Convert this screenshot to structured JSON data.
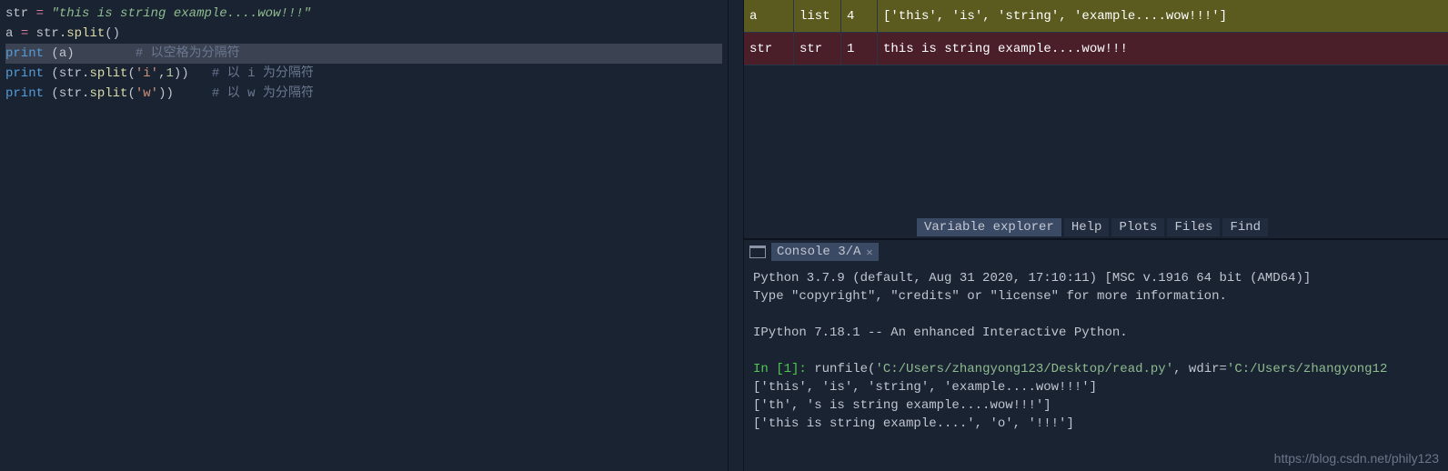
{
  "editor": {
    "lines": [
      {
        "spans": [
          {
            "t": "str",
            "c": "var"
          },
          {
            "t": " ",
            "c": ""
          },
          {
            "t": "=",
            "c": "op"
          },
          {
            "t": " ",
            "c": ""
          },
          {
            "t": "\"this is string example....wow!!!\"",
            "c": "str"
          }
        ]
      },
      {
        "spans": [
          {
            "t": "a ",
            "c": "var"
          },
          {
            "t": "=",
            "c": "op"
          },
          {
            "t": " str",
            "c": "var"
          },
          {
            "t": ".",
            "c": ""
          },
          {
            "t": "split",
            "c": "fn"
          },
          {
            "t": "()",
            "c": ""
          }
        ]
      },
      {
        "highlight": true,
        "spans": [
          {
            "t": "print",
            "c": "kw"
          },
          {
            "t": " (a)        ",
            "c": ""
          },
          {
            "t": "# 以空格为分隔符",
            "c": "cmt"
          }
        ]
      },
      {
        "spans": [
          {
            "t": "print",
            "c": "kw"
          },
          {
            "t": " (str",
            "c": ""
          },
          {
            "t": ".",
            "c": ""
          },
          {
            "t": "split",
            "c": "fn"
          },
          {
            "t": "(",
            "c": ""
          },
          {
            "t": "'i'",
            "c": "strq"
          },
          {
            "t": ",",
            "c": ""
          },
          {
            "t": "1",
            "c": "num"
          },
          {
            "t": "))   ",
            "c": ""
          },
          {
            "t": "# 以 i 为分隔符",
            "c": "cmt"
          }
        ]
      },
      {
        "spans": [
          {
            "t": "print",
            "c": "kw"
          },
          {
            "t": " (str",
            "c": ""
          },
          {
            "t": ".",
            "c": ""
          },
          {
            "t": "split",
            "c": "fn"
          },
          {
            "t": "(",
            "c": ""
          },
          {
            "t": "'w'",
            "c": "strq"
          },
          {
            "t": "))     ",
            "c": ""
          },
          {
            "t": "# 以 w 为分隔符",
            "c": "cmt"
          }
        ]
      }
    ]
  },
  "variables": [
    {
      "name": "a",
      "type": "list",
      "size": "4",
      "value": "['this', 'is', 'string', 'example....wow!!!']",
      "rowclass": "row-a"
    },
    {
      "name": "str",
      "type": "str",
      "size": "1",
      "value": "this is string example....wow!!!",
      "rowclass": "row-str"
    }
  ],
  "tabs": {
    "items": [
      {
        "label": "Variable explorer",
        "active": true
      },
      {
        "label": "Help",
        "active": false
      },
      {
        "label": "Plots",
        "active": false
      },
      {
        "label": "Files",
        "active": false
      },
      {
        "label": "Find",
        "active": false
      }
    ]
  },
  "console": {
    "tab_label": "Console 3/A",
    "lines": [
      {
        "spans": [
          {
            "t": "Python 3.7.9 (default, Aug 31 2020, 17:10:11) [MSC v.1916 64 bit (AMD64)]",
            "c": ""
          }
        ]
      },
      {
        "spans": [
          {
            "t": "Type \"copyright\", \"credits\" or \"license\" for more information.",
            "c": ""
          }
        ]
      },
      {
        "spans": [
          {
            "t": "",
            "c": ""
          }
        ]
      },
      {
        "spans": [
          {
            "t": "IPython 7.18.1 -- An enhanced Interactive Python.",
            "c": ""
          }
        ]
      },
      {
        "spans": [
          {
            "t": "",
            "c": ""
          }
        ]
      },
      {
        "spans": [
          {
            "t": "In [",
            "c": "pr-in"
          },
          {
            "t": "1",
            "c": "pr-in"
          },
          {
            "t": "]: ",
            "c": "pr-in"
          },
          {
            "t": "runfile(",
            "c": ""
          },
          {
            "t": "'C:/Users/zhangyong123/Desktop/read.py'",
            "c": "pr-path"
          },
          {
            "t": ", wdir=",
            "c": ""
          },
          {
            "t": "'C:/Users/zhangyong12",
            "c": "pr-path"
          }
        ]
      },
      {
        "spans": [
          {
            "t": "['this', 'is', 'string', 'example....wow!!!']",
            "c": ""
          }
        ]
      },
      {
        "spans": [
          {
            "t": "['th', 's is string example....wow!!!']",
            "c": ""
          }
        ]
      },
      {
        "spans": [
          {
            "t": "['this is string example....', 'o', '!!!']",
            "c": ""
          }
        ]
      }
    ]
  },
  "watermark": "https://blog.csdn.net/phily123"
}
